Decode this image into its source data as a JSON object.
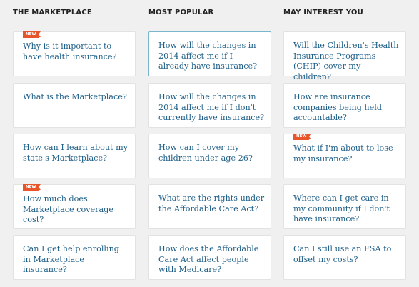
{
  "columns": [
    {
      "title": "THE MARKETPLACE",
      "items": [
        {
          "text": "Why is it important to have health insurance?",
          "badge": "NEW"
        },
        {
          "text": "What is the Marketplace?"
        },
        {
          "text": "How can I learn about my state's Marketplace?"
        },
        {
          "text": "How much does Marketplace coverage cost?",
          "badge": "NEW"
        },
        {
          "text": "Can I get help enrolling in Marketplace insurance?"
        }
      ]
    },
    {
      "title": "MOST POPULAR",
      "items": [
        {
          "text": "How will the changes in 2014 affect me if I already have insurance?"
        },
        {
          "text": "How will the changes in 2014 affect me if I don't currently have insurance?"
        },
        {
          "text": "How can I cover my children under age 26?"
        },
        {
          "text": "What are the rights under the Affordable Care Act?"
        },
        {
          "text": "How does the Affordable Care Act affect people with Medicare?"
        }
      ]
    },
    {
      "title": "MAY INTEREST YOU",
      "items": [
        {
          "text": "Will the Children's Health Insurance Programs (CHIP) cover my children?"
        },
        {
          "text": "How are insurance companies being held accountable?"
        },
        {
          "text": "What if I'm about to lose my insurance?",
          "badge": "NEW"
        },
        {
          "text": "Where can I get care in my community if I don't have insurance?"
        },
        {
          "text": "Can I still use an FSA to offset my costs?"
        }
      ]
    }
  ],
  "colors": {
    "link": "#1f5f88",
    "badge": "#e9552b",
    "highlight_border": "#7ab6cc",
    "background": "#f0f0f0"
  }
}
